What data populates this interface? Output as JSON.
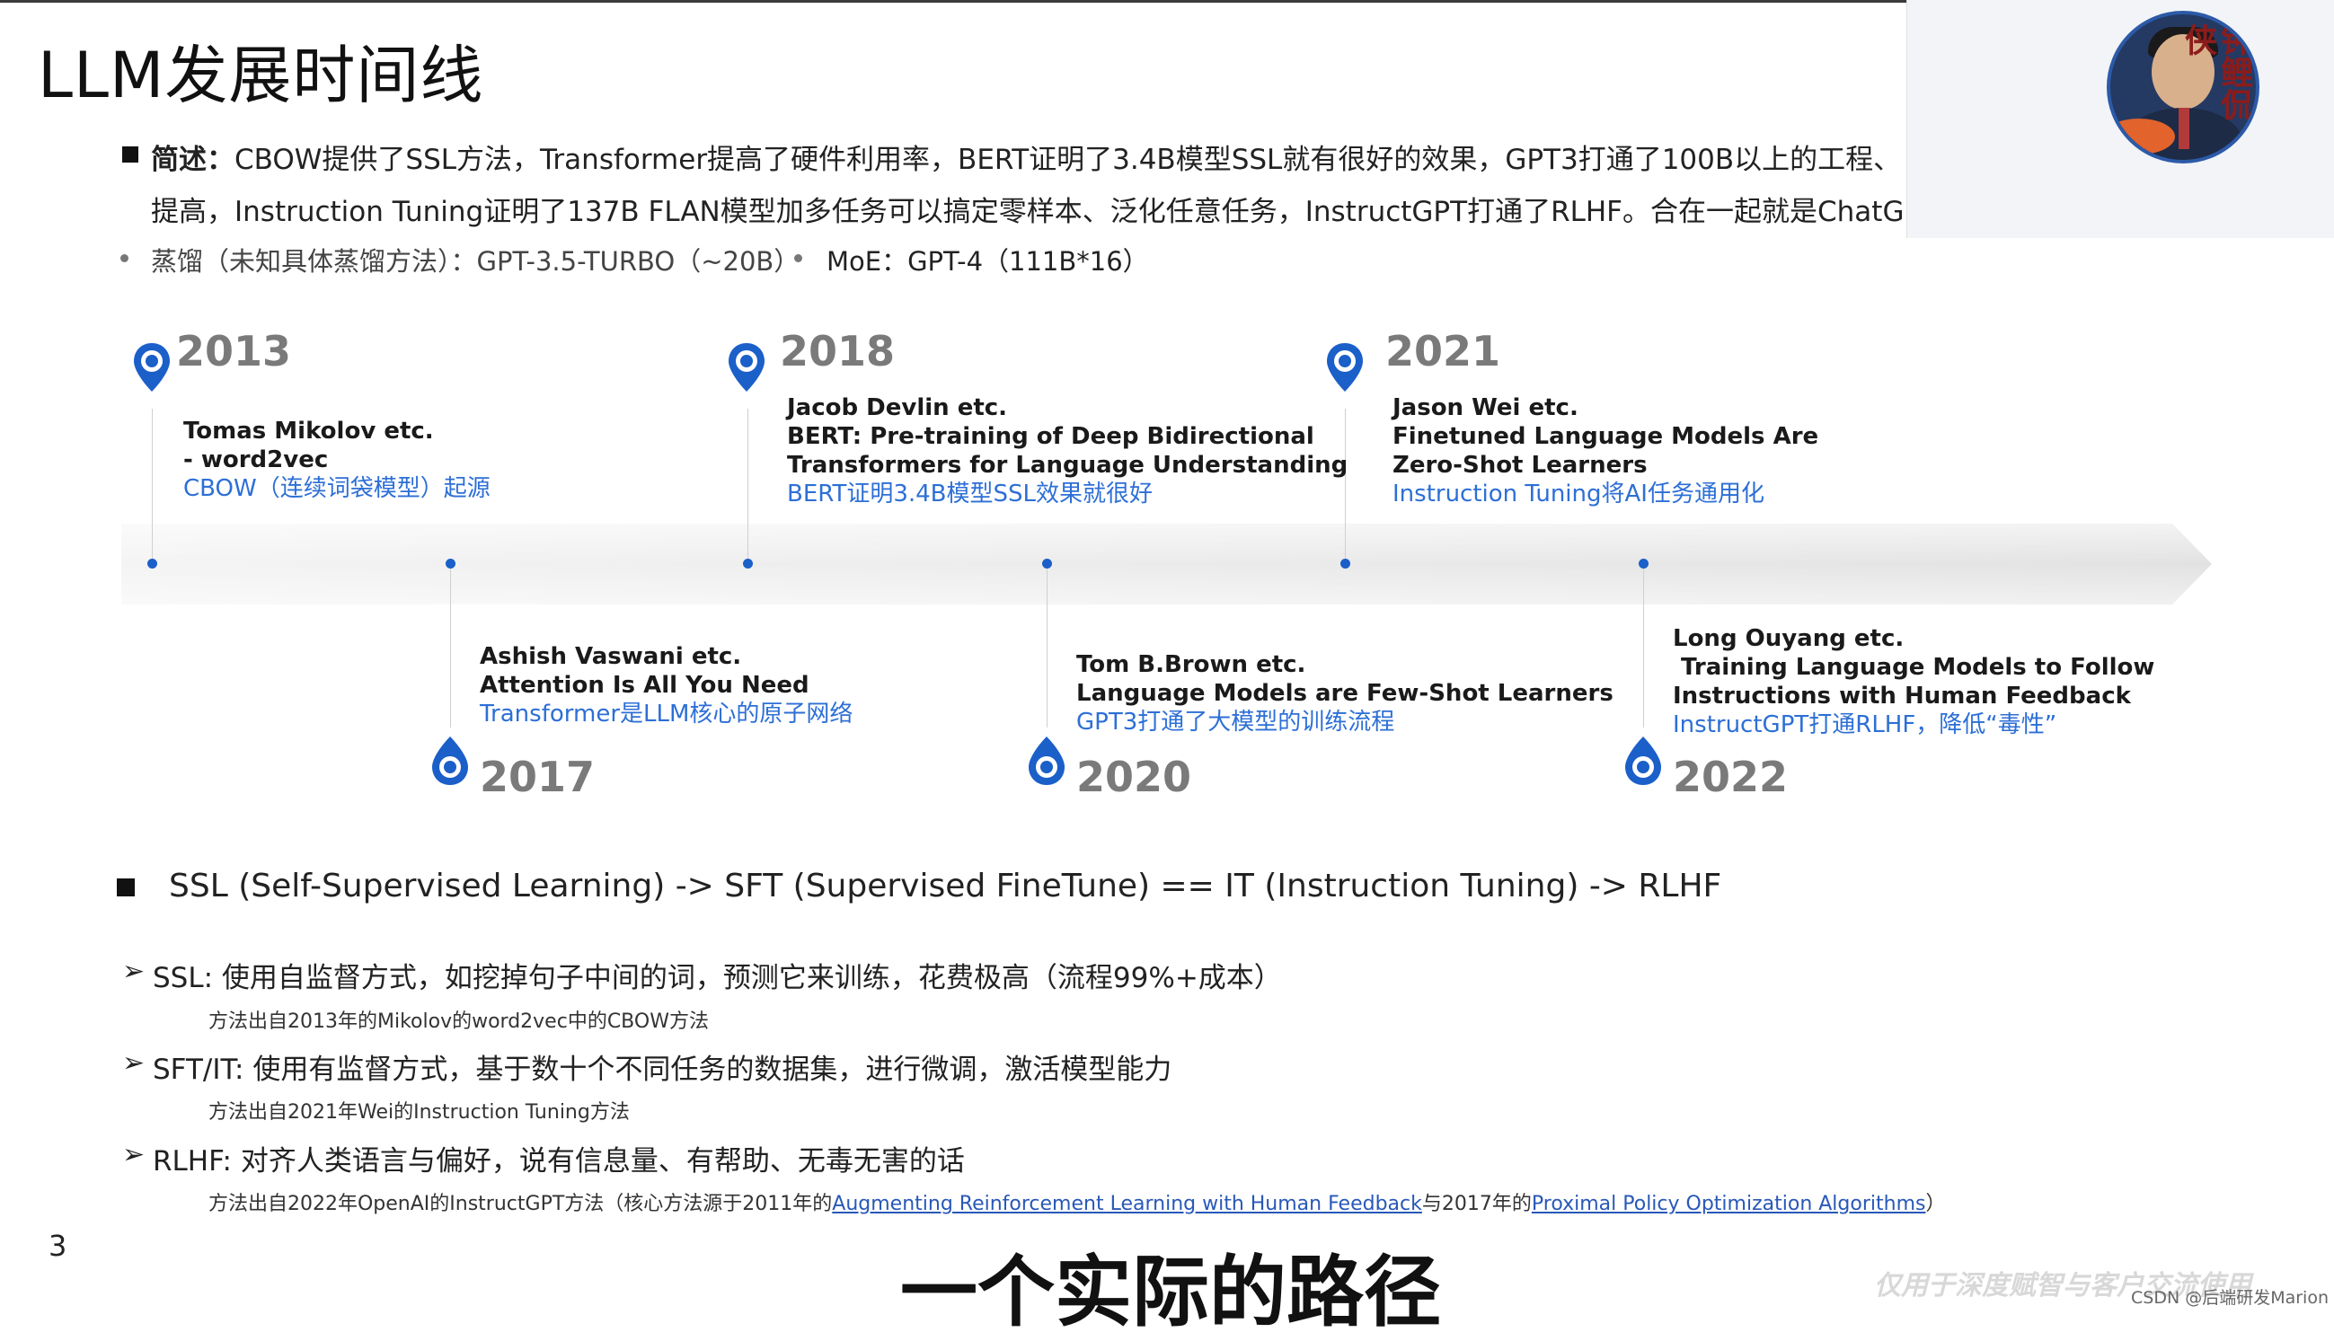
{
  "title": "LLM发展时间线",
  "summary": {
    "label": "简述：",
    "line1": "CBOW提供了SSL方法，Transformer提高了硬件利用率，BERT证明了3.4B模型SSL就有很好的效果，GPT3打通了100B以上的工程、",
    "line2": "提高，Instruction Tuning证明了137B FLAN模型加多任务可以搞定零样本、泛化任意任务，InstructGPT打通了RLHF。合在一起就是ChatG",
    "distill": "蒸馏（未知具体蒸馏方法）：GPT-3.5-TURBO（~20B）",
    "moe": "MoE：GPT-4（111B*16）"
  },
  "timeline": {
    "colors": {
      "accent": "#1b5fc9",
      "link": "#2d6fd6",
      "year": "#7a7a7a"
    },
    "above": [
      {
        "year": "2013",
        "authors": "Tomas Mikolov etc.",
        "title": "- word2vec",
        "title2": "",
        "comment": "CBOW（连续词袋模型）起源"
      },
      {
        "year": "2018",
        "authors": "Jacob Devlin etc.",
        "title": "BERT: Pre-training of Deep Bidirectional",
        "title2": "Transformers for Language Understanding",
        "comment": "BERT证明3.4B模型SSL效果就很好"
      },
      {
        "year": "2021",
        "authors": "Jason Wei etc.",
        "title": "Finetuned Language Models Are",
        "title2": "Zero-Shot Learners",
        "comment": "Instruction Tuning将AI任务通用化"
      }
    ],
    "below": [
      {
        "year": "2017",
        "authors": "Ashish Vaswani etc.",
        "title": "Attention Is All You Need",
        "comment": "Transformer是LLM核心的原子网络"
      },
      {
        "year": "2020",
        "authors": "Tom B.Brown etc.",
        "title": "Language Models are Few-Shot Learners",
        "comment": "GPT3打通了大模型的训练流程"
      },
      {
        "year": "2022",
        "authors": "Long Ouyang etc.",
        "title": " Training Language Models to Follow",
        "title2": "Instructions with Human Feedback",
        "comment": "InstructGPT打通RLHF，降低“毒性”"
      }
    ]
  },
  "section": "SSL (Self-Supervised Learning) -> SFT (Supervised FineTune) == IT (Instruction Tuning) -> RLHF",
  "bullets": [
    {
      "text": "SSL: 使用自监督方式，如挖掉句子中间的词，预测它来训练，花费极高（流程99%+成本）",
      "note": "方法出自2013年的Mikolov的word2vec中的CBOW方法"
    },
    {
      "text": "SFT/IT: 使用有监督方式，基于数十个不同任务的数据集，进行微调，激活模型能力",
      "note": "方法出自2021年Wei的Instruction Tuning方法"
    },
    {
      "text": "RLHF: 对齐人类语言与偏好，说有信息量、有帮助、无毒无害的话",
      "note_prefix": "方法出自2022年OpenAI的InstructGPT方法（核心方法源于2011年的",
      "link1": "Augmenting Reinforcement Learning with Human Feedback",
      "note_mid": "与2017年的",
      "link2": "Proximal Policy Optimization Algorithms",
      "note_suffix": "）"
    }
  ],
  "page_number": "3",
  "watermark": "仅用于深度赋智与客户交流使用",
  "subtitle": "一个实际的路径",
  "csdn": "CSDN @后端研发Marion",
  "seal_text": "钟鲤侃侠"
}
